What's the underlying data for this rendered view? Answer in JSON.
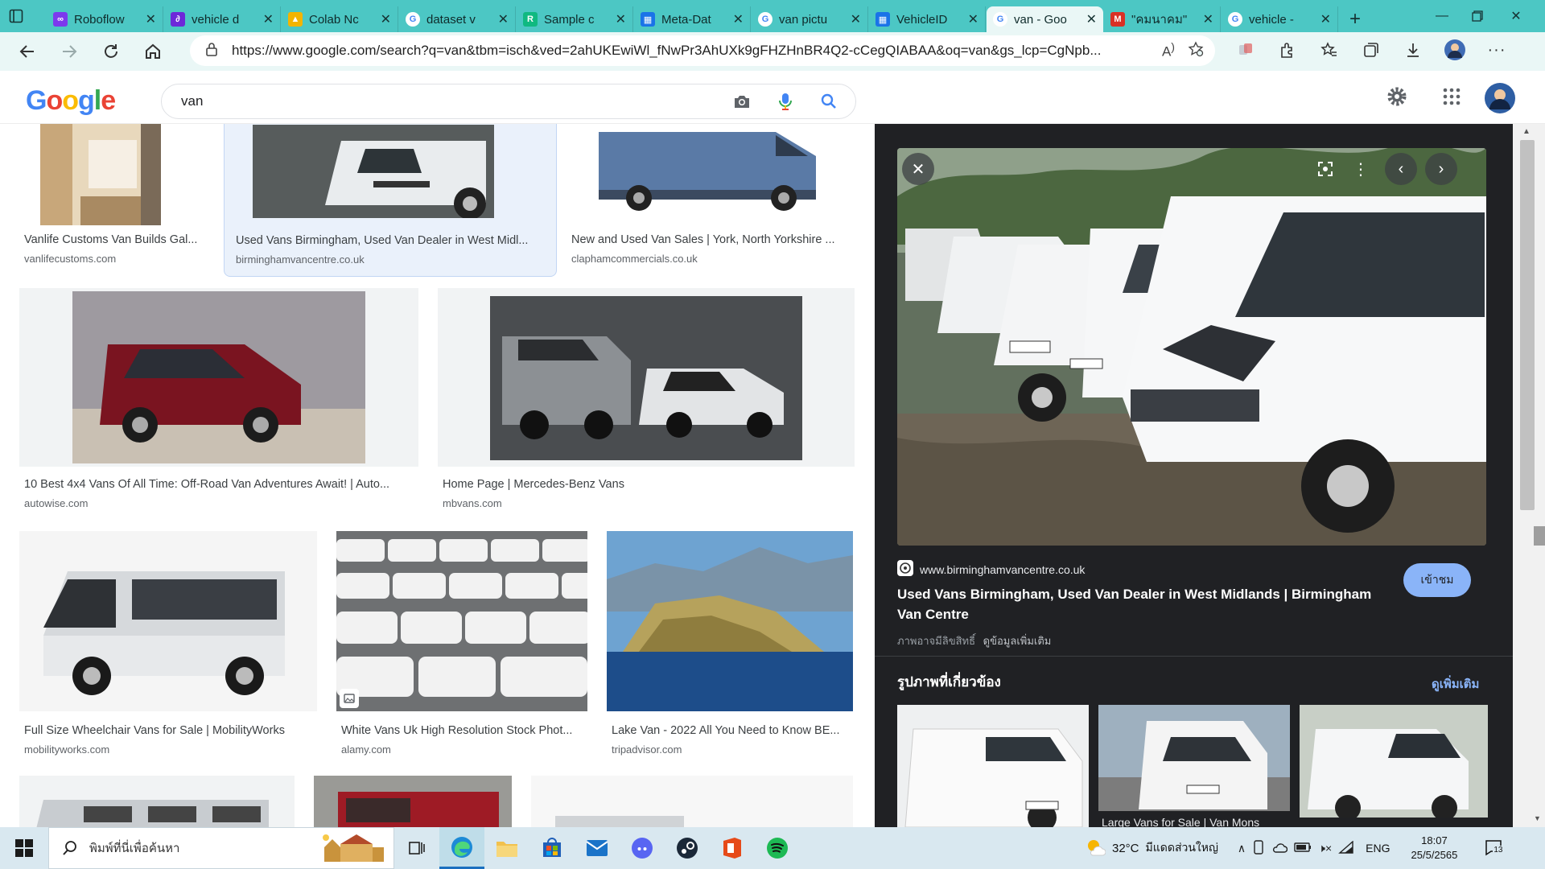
{
  "browser": {
    "tabs": [
      {
        "label": "Roboflow",
        "icon": "roboflow-icon",
        "color": "#7c3aed"
      },
      {
        "label": "vehicle d",
        "icon": "link-icon",
        "color": "#6d28d9"
      },
      {
        "label": "Colab Nc",
        "icon": "drive-icon",
        "color": "#f4b400"
      },
      {
        "label": "dataset v",
        "icon": "google-icon",
        "color": "#4285f4"
      },
      {
        "label": "Sample c",
        "icon": "r6-icon",
        "color": "#10b981"
      },
      {
        "label": "Meta-Dat",
        "icon": "meta-icon",
        "color": "#1a73e8"
      },
      {
        "label": "van pictu",
        "icon": "google-icon",
        "color": "#4285f4"
      },
      {
        "label": "VehicleID",
        "icon": "meta-icon",
        "color": "#1a73e8"
      },
      {
        "label": "van - Goo",
        "icon": "google-icon",
        "color": "#4285f4",
        "active": true
      },
      {
        "label": "\"คมนาคม\"",
        "icon": "gmail-icon",
        "color": "#d93025"
      },
      {
        "label": "vehicle -",
        "icon": "google-icon",
        "color": "#4285f4"
      }
    ],
    "new_tab": "+",
    "url": "https://www.google.com/search?q=van&tbm=isch&ved=2ahUKEwiWl_fNwPr3AhUXk9gFHZHnBR4Q2-cCegQIABAA&oq=van&gs_lcp=CgNpb..."
  },
  "google": {
    "logo": "Google",
    "query": "van"
  },
  "results": [
    {
      "title": "Vanlife Customs Van Builds Gal...",
      "source": "vanlifecustoms.com"
    },
    {
      "title": "Used Vans Birmingham, Used Van Dealer in West Midl...",
      "source": "birminghamvancentre.co.uk",
      "selected": true
    },
    {
      "title": "New and Used Van Sales | York, North Yorkshire ...",
      "source": "claphamcommercials.co.uk"
    },
    {
      "title": "10 Best 4x4 Vans Of All Time: Off-Road Van Adventures Await! | Auto...",
      "source": "autowise.com"
    },
    {
      "title": "Home Page | Mercedes-Benz Vans",
      "source": "mbvans.com"
    },
    {
      "title": "Full Size Wheelchair Vans for Sale | MobilityWorks",
      "source": "mobilityworks.com"
    },
    {
      "title": "White Vans Uk High Resolution Stock Phot...",
      "source": "alamy.com"
    },
    {
      "title": "Lake Van - 2022 All You Need to Know BE...",
      "source": "tripadvisor.com"
    }
  ],
  "preview": {
    "domain": "www.birminghamvancentre.co.uk",
    "title": "Used Vans Birmingham, Used Van Dealer in West Midlands | Birmingham Van Centre",
    "copyright": "ภาพอาจมีลิขสิทธิ์",
    "more_info": "ดูข้อมูลเพิ่มเติม",
    "visit": "เข้าชม",
    "related_heading": "รูปภาพที่เกี่ยวข้อง",
    "see_more": "ดูเพิ่มเติม",
    "related_caption": "Large Vans for Sale | Van Mons"
  },
  "taskbar": {
    "search_placeholder": "พิมพ์ที่นี่เพื่อค้นหา",
    "weather_temp": "32°C",
    "weather_text": "มีแดดส่วนใหญ่",
    "lang": "ENG",
    "time": "18:07",
    "date": "25/5/2565",
    "notif_count": "13"
  },
  "colors": {
    "tab_strip": "#4cc7c4",
    "toolbar": "#eaf7f6",
    "preview_bg": "#202124",
    "link_blue": "#8ab4f8"
  }
}
